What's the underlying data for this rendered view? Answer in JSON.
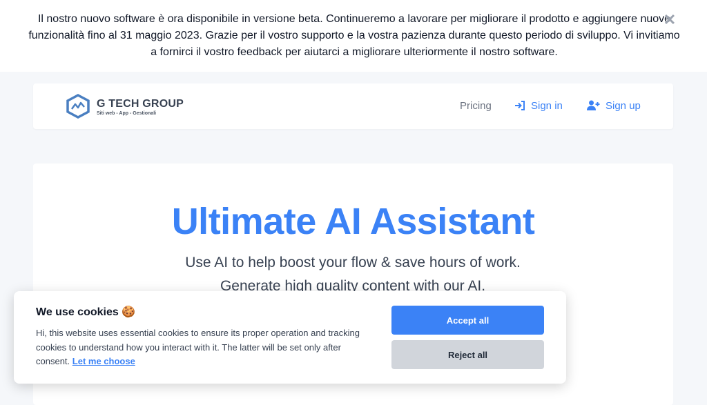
{
  "banner": {
    "text": "Il nostro nuovo software è ora disponibile in versione beta. Continueremo a lavorare per migliorare il prodotto e aggiungere nuove funzionalità fino al 31 maggio 2023. Grazie per il vostro supporto e la vostra pazienza durante questo periodo di sviluppo. Vi invitiamo a fornirci il vostro feedback per aiutarci a migliorare ulteriormente il nostro software.",
    "close_symbol": "✕"
  },
  "navbar": {
    "logo_title": "G TECH GROUP",
    "logo_subtitle": "Siti web - App - Gestionali",
    "pricing": "Pricing",
    "sign_in": "Sign in",
    "sign_up": "Sign up"
  },
  "hero": {
    "title": "Ultimate AI Assistant",
    "subtitle": "Use AI to help boost your flow & save hours of work. Generate high quality content with our AI."
  },
  "cookie": {
    "title": "We use cookies 🍪",
    "description": "Hi, this website uses essential cookies to ensure its proper operation and tracking cookies to understand how you interact with it. The latter will be set only after consent.",
    "link": "Let me choose",
    "accept": "Accept all",
    "reject": "Reject all"
  },
  "colors": {
    "accent": "#3b82f6",
    "background": "#f5f7fa",
    "reject_button": "#d1d5db"
  }
}
